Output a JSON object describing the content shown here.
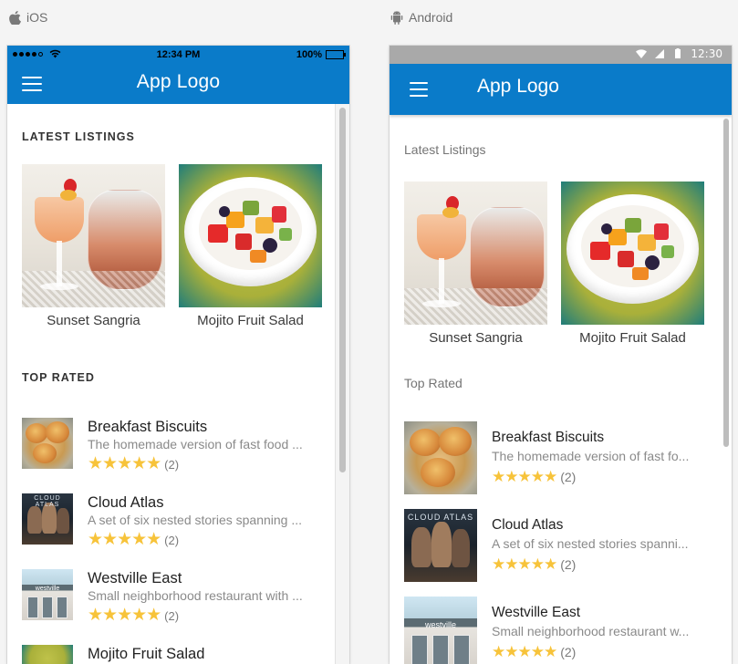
{
  "platforms": {
    "ios_label": "iOS",
    "android_label": "Android"
  },
  "ios": {
    "status": {
      "time": "12:34 PM",
      "battery": "100%"
    },
    "header": {
      "logo": "App Logo"
    },
    "latest_title": "LATEST LISTINGS",
    "top_rated_title": "TOP RATED",
    "latest": [
      {
        "caption": "Sunset Sangria"
      },
      {
        "caption": "Mojito Fruit Salad"
      }
    ],
    "top_rated": [
      {
        "title": "Breakfast Biscuits",
        "desc": "The homemade version of fast food ...",
        "rating": 5,
        "stars": "★★★★★",
        "count": "(2)"
      },
      {
        "title": "Cloud Atlas",
        "desc": "A set of six nested stories spanning ...",
        "rating": 5,
        "stars": "★★★★★",
        "count": "(2)"
      },
      {
        "title": "Westville East",
        "desc": "Small neighborhood restaurant with ...",
        "rating": 5,
        "stars": "★★★★★",
        "count": "(2)"
      },
      {
        "title": "Mojito Fruit Salad"
      }
    ]
  },
  "android": {
    "status": {
      "time": "12:30"
    },
    "header": {
      "logo": "App Logo"
    },
    "latest_title": "Latest Listings",
    "top_rated_title": "Top Rated",
    "latest": [
      {
        "caption": "Sunset Sangria"
      },
      {
        "caption": "Mojito Fruit Salad"
      }
    ],
    "top_rated": [
      {
        "title": "Breakfast Biscuits",
        "desc": "The homemade version of fast fo...",
        "rating": 5,
        "stars": "★★★★★",
        "count": "(2)"
      },
      {
        "title": "Cloud Atlas",
        "desc": "A set of six nested stories spanni...",
        "rating": 5,
        "stars": "★★★★★",
        "count": "(2)"
      },
      {
        "title": "Westville East",
        "desc": "Small neighborhood restaurant w...",
        "rating": 5,
        "stars": "★★★★★",
        "count": "(2)"
      }
    ]
  },
  "colors": {
    "brand_blue": "#0a7bc9",
    "star": "#f7c33a",
    "android_status_bar": "#a9a9a9"
  },
  "icons": {
    "ios_platform": "apple-icon",
    "android_platform": "android-icon",
    "menu": "hamburger-menu-icon",
    "star": "star-icon",
    "wifi": "wifi-icon",
    "cell": "cell-signal-icon",
    "battery": "battery-icon"
  }
}
